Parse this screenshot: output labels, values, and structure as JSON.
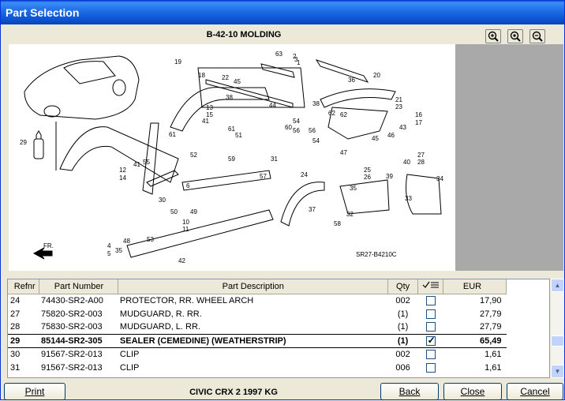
{
  "window": {
    "title": "Part Selection"
  },
  "diagram": {
    "title": "B-42-10 MOLDING",
    "ref_code": "SR27-B4210C",
    "direction_label": "FR.",
    "callouts": [
      "1",
      "2",
      "3",
      "4",
      "5",
      "6",
      "10",
      "11",
      "12",
      "13",
      "14",
      "15",
      "16",
      "17",
      "18",
      "19",
      "20",
      "21",
      "22",
      "23",
      "24",
      "25",
      "26",
      "27",
      "28",
      "29",
      "30",
      "32",
      "33",
      "34",
      "35",
      "36",
      "37",
      "38",
      "39",
      "40",
      "41",
      "42",
      "43",
      "44",
      "45",
      "46",
      "47",
      "48",
      "49",
      "50",
      "51",
      "52",
      "53",
      "54",
      "55",
      "56",
      "57",
      "58",
      "59",
      "60",
      "61",
      "62",
      "63"
    ]
  },
  "zoom": {
    "in_icon": "zoom-in-icon",
    "fit_icon": "zoom-fit-icon",
    "out_icon": "zoom-out-icon"
  },
  "table": {
    "headers": {
      "refnr": "Refnr",
      "part_number": "Part Number",
      "description": "Part Description",
      "qty": "Qty",
      "select_icon": "checklist-icon",
      "eur": "EUR"
    },
    "rows": [
      {
        "refnr": "24",
        "part_number": "74430-SR2-A00",
        "description": "PROTECTOR, RR. WHEEL ARCH",
        "qty": "002",
        "checked": false,
        "eur": "17,90"
      },
      {
        "refnr": "27",
        "part_number": "75820-SR2-003",
        "description": "MUDGUARD, R. RR.",
        "qty": "(1)",
        "checked": false,
        "eur": "27,79"
      },
      {
        "refnr": "28",
        "part_number": "75830-SR2-003",
        "description": "MUDGUARD, L. RR.",
        "qty": "(1)",
        "checked": false,
        "eur": "27,79"
      },
      {
        "refnr": "29",
        "part_number": "85144-SR2-305",
        "description": "SEALER (CEMEDINE) (WEATHERSTRIP)",
        "qty": "(1)",
        "checked": true,
        "eur": "65,49",
        "selected": true
      },
      {
        "refnr": "30",
        "part_number": "91567-SR2-013",
        "description": "CLIP",
        "qty": "002",
        "checked": false,
        "eur": "1,61"
      },
      {
        "refnr": "31",
        "part_number": "91567-SR2-013",
        "description": "CLIP",
        "qty": "006",
        "checked": false,
        "eur": "1,61"
      }
    ]
  },
  "footer": {
    "print": "Print",
    "vehicle": "CIVIC CRX  2  1997  KG",
    "back": "Back",
    "close": "Close",
    "cancel": "Cancel"
  }
}
